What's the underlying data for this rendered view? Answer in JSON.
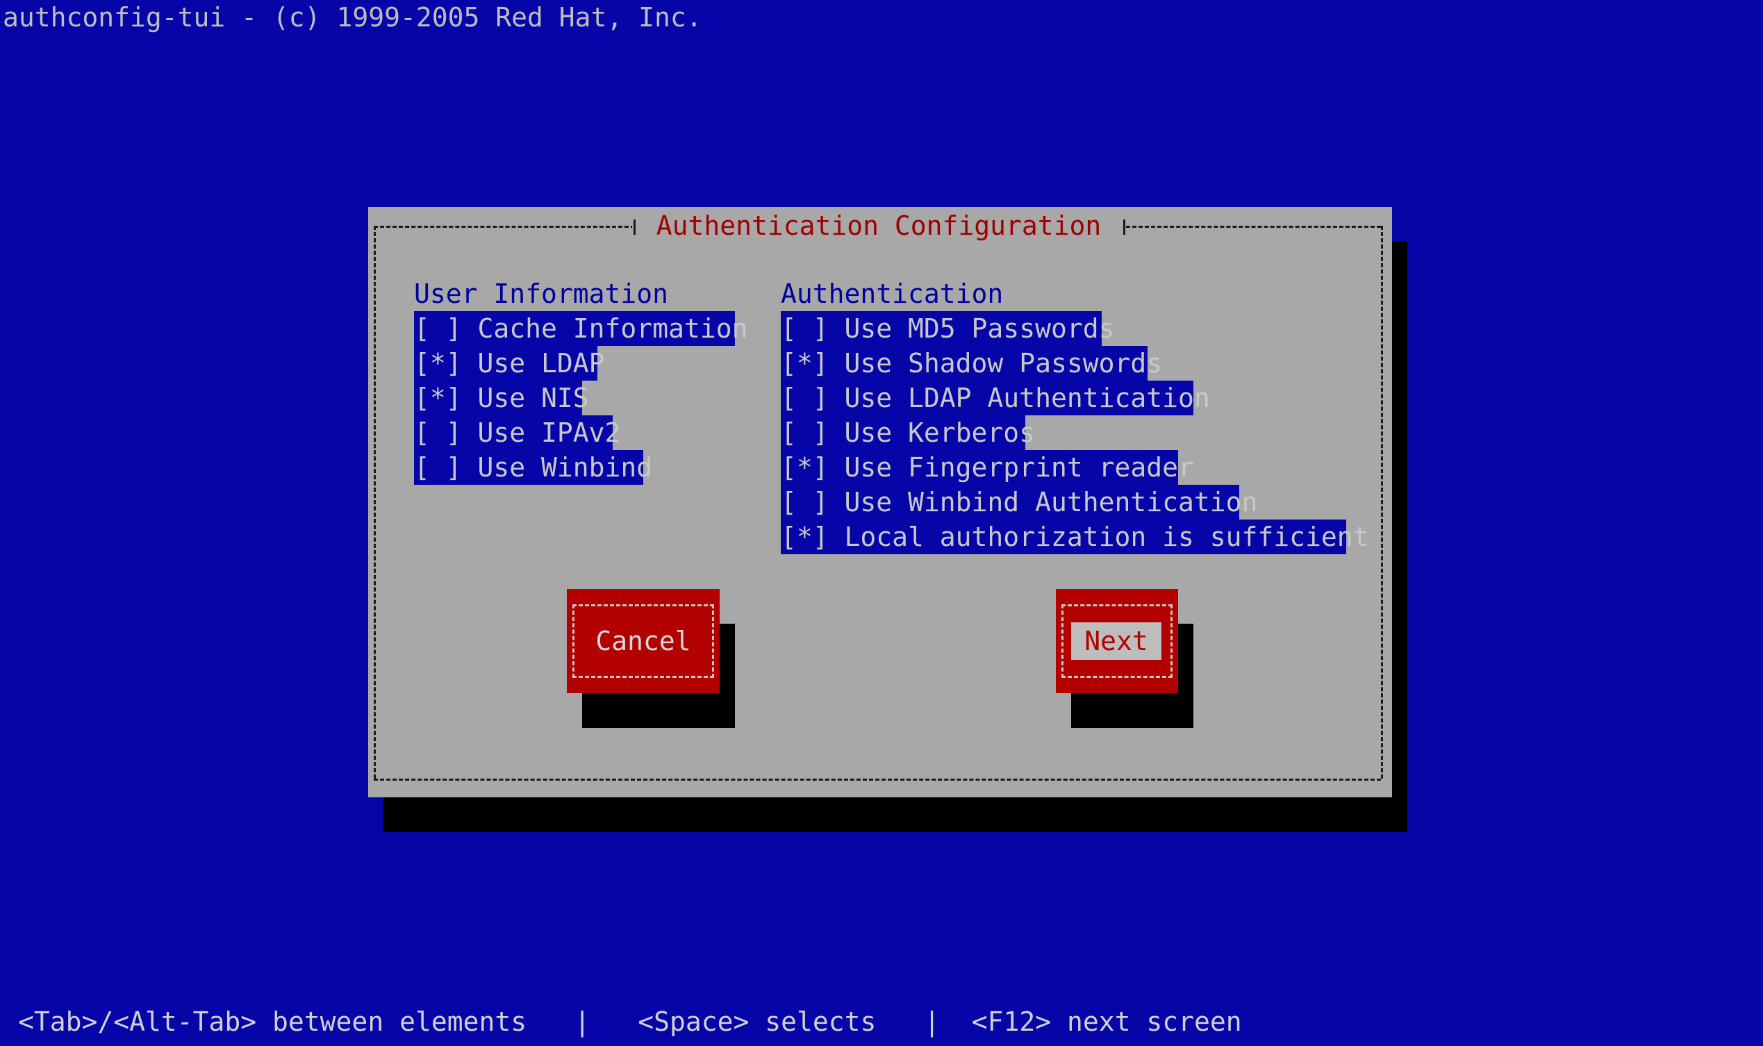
{
  "header": {
    "text": "authconfig-tui - (c) 1999-2005 Red Hat, Inc."
  },
  "dialog": {
    "title": "Authentication Configuration",
    "user_info": {
      "heading": "User Information",
      "items": [
        {
          "mark": "[ ]",
          "label": "Cache Information"
        },
        {
          "mark": "[*]",
          "label": "Use LDAP"
        },
        {
          "mark": "[*]",
          "label": "Use NIS"
        },
        {
          "mark": "[ ]",
          "label": "Use IPAv2"
        },
        {
          "mark": "[ ]",
          "label": "Use Winbind"
        }
      ]
    },
    "authentication": {
      "heading": "Authentication",
      "items": [
        {
          "mark": "[ ]",
          "label": "Use MD5 Passwords"
        },
        {
          "mark": "[*]",
          "label": "Use Shadow Passwords"
        },
        {
          "mark": "[ ]",
          "label": "Use LDAP Authentication"
        },
        {
          "mark": "[ ]",
          "label": "Use Kerberos"
        },
        {
          "mark": "[*]",
          "label": "Use Fingerprint reader"
        },
        {
          "mark": "[ ]",
          "label": "Use Winbind Authentication"
        },
        {
          "mark": "[*]",
          "label": "Local authorization is sufficient"
        }
      ]
    },
    "buttons": {
      "cancel": "Cancel",
      "next": "Next"
    }
  },
  "footer": {
    "hint1": "<Tab>/<Alt-Tab> between elements",
    "sep": "|",
    "hint2": "<Space> selects",
    "hint3": "<F12> next screen"
  },
  "colors": {
    "background": "#0505a8",
    "dialog": "#a8a8a8",
    "title": "#a00000",
    "button": "#b30000"
  }
}
